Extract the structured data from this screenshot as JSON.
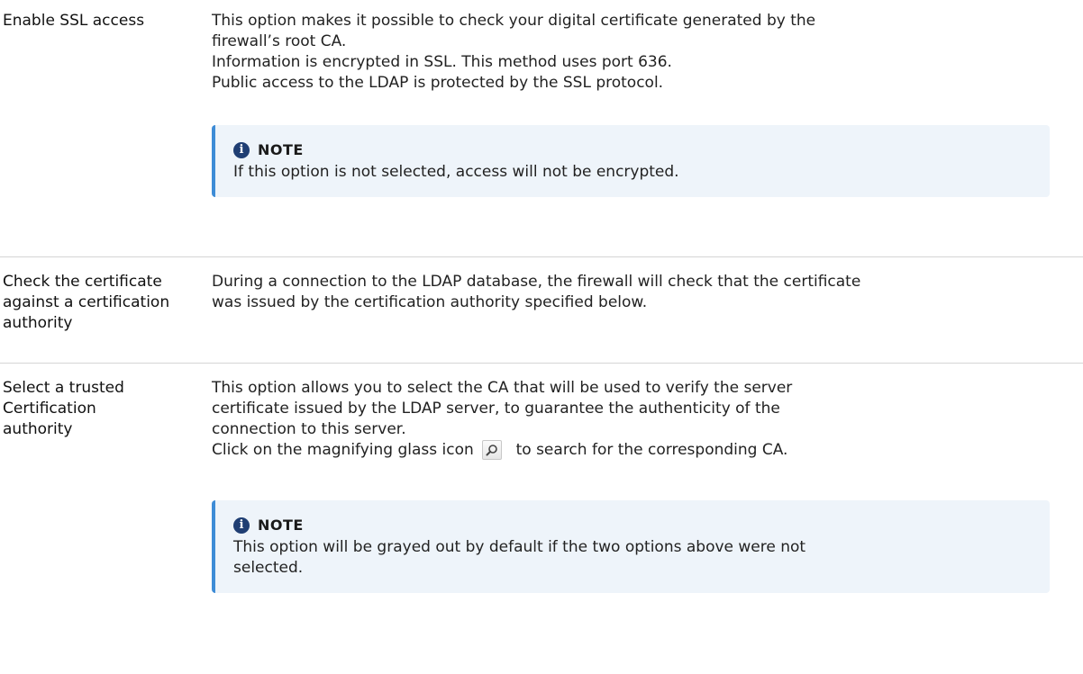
{
  "rows": [
    {
      "term": "Enable SSL access",
      "desc_lines": [
        "This option makes it possible to check your digital certificate generated by the",
        "firewall’s root CA.",
        "Information is encrypted in SSL. This method uses port 636.",
        "Public access to the LDAP is protected by the SSL protocol."
      ],
      "note": {
        "title": "NOTE",
        "text": "If this option is not selected, access will not be encrypted."
      }
    },
    {
      "term_lines": [
        "Check the certificate",
        "against a certification",
        "authority"
      ],
      "desc_lines": [
        "During a connection to the LDAP database, the firewall will check that the certificate",
        "was issued by the certification authority specified below."
      ]
    },
    {
      "term_lines": [
        "Select a trusted",
        "Certification",
        "authority"
      ],
      "desc_lines": [
        "This option allows you to select the CA that will be used to verify the server",
        "certificate issued by the LDAP server, to guarantee the authenticity of the",
        "connection to this server."
      ],
      "icon_line": {
        "before": "Click on the magnifying glass icon",
        "after": "to search for the corresponding CA.",
        "icon": "magnifying-glass-icon"
      },
      "note": {
        "title": "NOTE",
        "text_lines": [
          "This option will be grayed out by default if the two options above were not",
          "selected."
        ]
      }
    }
  ],
  "colors": {
    "note_background": "#eef4fa",
    "note_accent": "#3e8cd6",
    "info_icon": "#1f3e73",
    "divider": "#d5d5d5"
  }
}
